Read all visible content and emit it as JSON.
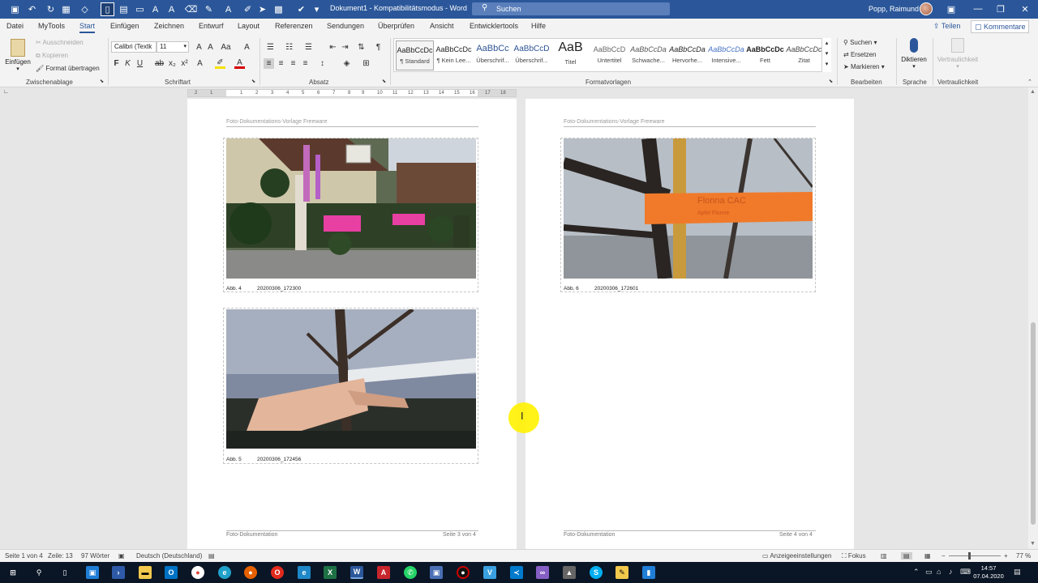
{
  "window": {
    "doc_title": "Dokument1 - Kompatibilitätsmodus - Word",
    "search_label": "Suchen",
    "user_name": "Popp, Raimund"
  },
  "menu": {
    "tabs": [
      "Datei",
      "MyTools",
      "Start",
      "Einfügen",
      "Zeichnen",
      "Entwurf",
      "Layout",
      "Referenzen",
      "Sendungen",
      "Überprüfen",
      "Ansicht",
      "Entwicklertools",
      "Hilfe"
    ],
    "share": "Teilen",
    "comments": "Kommentare"
  },
  "ribbon": {
    "clipboard": {
      "paste": "Einfügen",
      "cut": "Ausschneiden",
      "copy": "Kopieren",
      "format_painter": "Format übertragen",
      "label": "Zwischenablage"
    },
    "font": {
      "name": "Calibri (Textk",
      "size": "11",
      "label": "Schriftart"
    },
    "paragraph": {
      "label": "Absatz"
    },
    "styles": {
      "label": "Formatvorlagen",
      "items": [
        {
          "preview": "AaBbCcDc",
          "name": "¶ Standard"
        },
        {
          "preview": "AaBbCcDc",
          "name": "¶ Kein Lee..."
        },
        {
          "preview": "AaBbCc",
          "name": "Überschrif..."
        },
        {
          "preview": "AaBbCcD",
          "name": "Überschrif..."
        },
        {
          "preview": "AaB",
          "name": "Titel"
        },
        {
          "preview": "AaBbCcD",
          "name": "Untertitel"
        },
        {
          "preview": "AaBbCcDa",
          "name": "Schwache..."
        },
        {
          "preview": "AaBbCcDa",
          "name": "Hervorhe..."
        },
        {
          "preview": "AaBbCcDa",
          "name": "Intensive..."
        },
        {
          "preview": "AaBbCcDc",
          "name": "Fett"
        },
        {
          "preview": "AaBbCcDc",
          "name": "Zitat"
        }
      ]
    },
    "editing": {
      "find": "Suchen",
      "replace": "Ersetzen",
      "select": "Markieren",
      "label": "Bearbeiten"
    },
    "voice": {
      "dictate": "Diktieren",
      "label": "Sprache"
    },
    "sensitivity": {
      "button": "Vertraulichkeit",
      "label": "Vertraulichkeit"
    }
  },
  "ruler": {
    "ticks": [
      "2",
      "1",
      "1",
      "2",
      "3",
      "4",
      "5",
      "6",
      "7",
      "8",
      "9",
      "10",
      "11",
      "12",
      "13",
      "14",
      "15",
      "16",
      "17",
      "18"
    ]
  },
  "pages": [
    {
      "header": "Foto-Dokumentations-Vorlage  Freeware",
      "footer_left": "Foto-Dokumentation",
      "footer_right": "Seite 3 von 4",
      "photos": [
        {
          "label": "Abb. 4",
          "name": "20200306_172300"
        },
        {
          "label": "Abb. 5",
          "name": "20200306_172456"
        }
      ]
    },
    {
      "header": "Foto-Dokumentations-Vorlage  Freeware",
      "footer_left": "Foto-Dokumentation",
      "footer_right": "Seite 4 von 4",
      "photos": [
        {
          "label": "Abb. 6",
          "name": "20200306_172601"
        }
      ]
    }
  ],
  "status": {
    "page": "Seite 1 von 4",
    "line": "Zeile: 13",
    "words": "97 Wörter",
    "language": "Deutsch (Deutschland)",
    "display_settings": "Anzeigeeinstellungen",
    "focus": "Fokus",
    "zoom": "77 %"
  },
  "taskbar": {
    "time": "14:57",
    "date": "07.04.2020"
  },
  "colors": {
    "word_blue": "#2b579a",
    "tag_orange": "#f07a2a",
    "cursor_highlight": "#fff200"
  }
}
